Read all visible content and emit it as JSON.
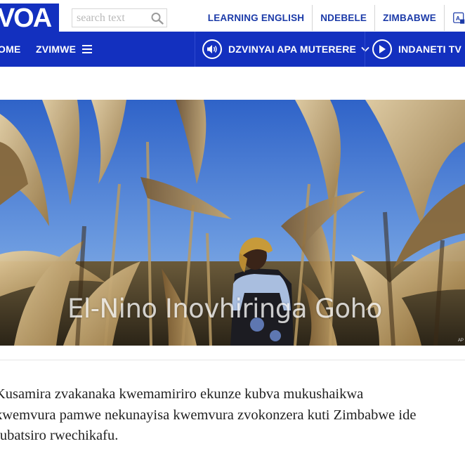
{
  "header": {
    "logo_text": "VOA",
    "search": {
      "placeholder": "search text",
      "icon": "search-icon"
    },
    "links": [
      "LEARNING ENGLISH",
      "NDEBELE",
      "ZIMBABWE"
    ],
    "language_icon": "language-icon"
  },
  "nav": {
    "home": "OME",
    "more": "ZVIMWE",
    "radio": "DZVINYAI APA MUTERERE",
    "tv": "INDANETI TV",
    "colors": {
      "bar": "#1330bf",
      "link": "#1b3aa8"
    }
  },
  "hero": {
    "caption": "El-Nino Inovhiringa Goho",
    "credit": "AP"
  },
  "article": {
    "lines": [
      "Kusamira zvakanaka kwemamiriro ekunze kubva mukushaikwa",
      "kwemvura pamwe nekunayisa kwemvura zvokonzera kuti Zimbabwe ide",
      "rubatsiro rwechikafu."
    ]
  }
}
